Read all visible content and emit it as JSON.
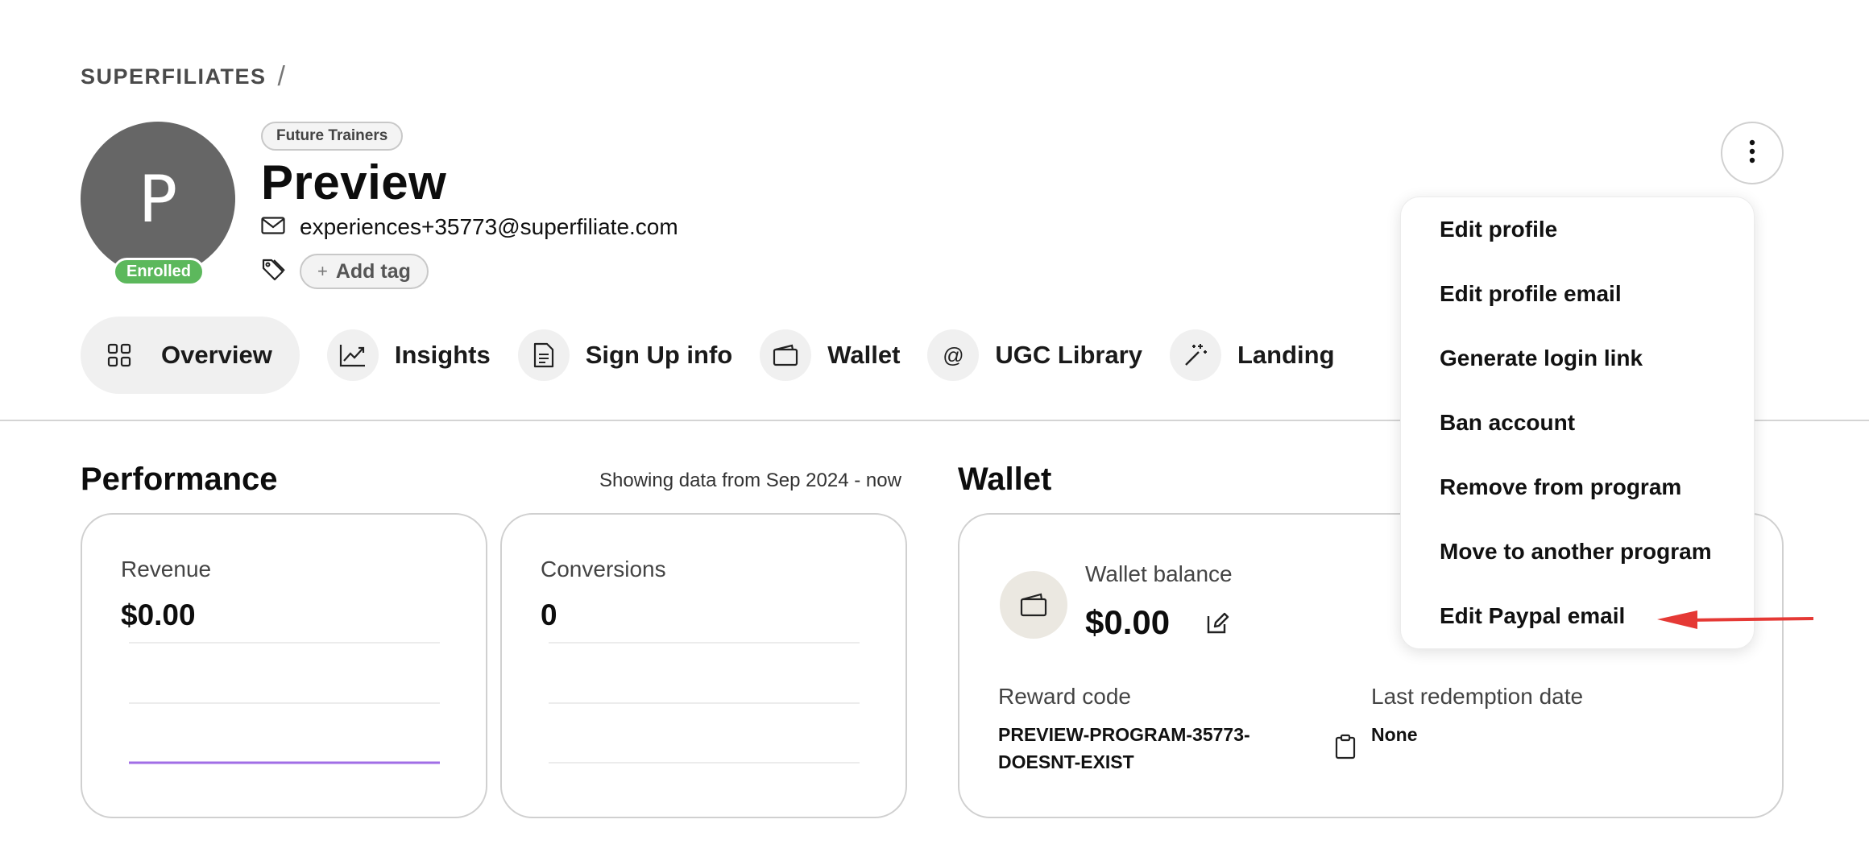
{
  "breadcrumb": {
    "brand": "SUPERFILIATES",
    "separator": "/"
  },
  "profile": {
    "avatar_initial": "P",
    "status_badge": "Enrolled",
    "group_tag": "Future Trainers",
    "name": "Preview",
    "email": "experiences+35773@superfiliate.com",
    "add_tag_plus": "+",
    "add_tag_label": "Add tag"
  },
  "tabs": [
    {
      "label": "Overview",
      "icon": "grid-icon",
      "active": true
    },
    {
      "label": "Insights",
      "icon": "trend-chart-icon"
    },
    {
      "label": "Sign Up info",
      "icon": "document-icon"
    },
    {
      "label": "Wallet",
      "icon": "wallet-icon"
    },
    {
      "label": "UGC Library",
      "icon": "at-sign-icon"
    },
    {
      "label": "Landing",
      "icon": "magic-wand-icon"
    }
  ],
  "tab_at_glyph": "@",
  "performance": {
    "title": "Performance",
    "date_range": "Showing data from Sep 2024 - now",
    "revenue": {
      "label": "Revenue",
      "value": "$0.00"
    },
    "conversions": {
      "label": "Conversions",
      "value": "0"
    }
  },
  "wallet": {
    "title": "Wallet",
    "balance_label": "Wallet balance",
    "balance_value": "$0.00",
    "reward_code_label": "Reward code",
    "reward_code_line1": "PREVIEW-PROGRAM-35773-",
    "reward_code_line2": "DOESNT-EXIST",
    "last_redemption_label": "Last redemption date",
    "last_redemption_value": "None"
  },
  "menu": {
    "items": [
      "Edit profile",
      "Edit profile email",
      "Generate login link",
      "Ban account",
      "Remove from program",
      "Move to another program",
      "Edit Paypal email"
    ]
  },
  "colors": {
    "enrolled_badge": "#5cb85c",
    "avatar_bg": "#666666",
    "revenue_line": "#a16ee6",
    "annotation_arrow": "#e53935"
  }
}
